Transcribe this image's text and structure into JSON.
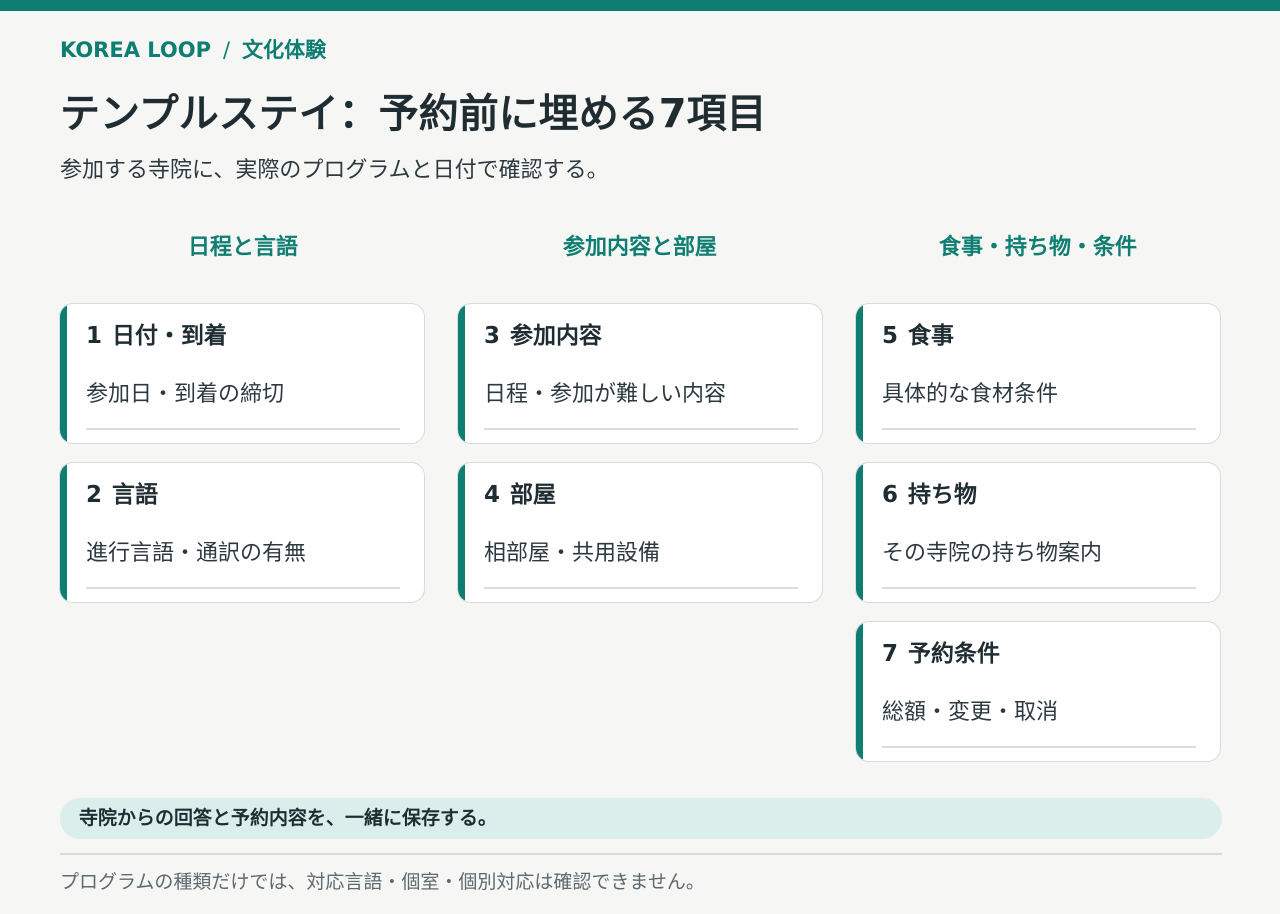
{
  "breadcrumb": {
    "site": "KOREA LOOP",
    "separator": "/",
    "section": "文化体験"
  },
  "header": {
    "title": "テンプルステイ：予約前に埋める7項目",
    "subtitle": "参加する寺院に、実際のプログラムと日付で確認する。"
  },
  "columns": [
    {
      "heading": "日程と言語",
      "cards": [
        {
          "num": "1",
          "title": "日付・到着",
          "desc": "参加日・到着の締切"
        },
        {
          "num": "2",
          "title": "言語",
          "desc": "進行言語・通訳の有無"
        }
      ]
    },
    {
      "heading": "参加内容と部屋",
      "cards": [
        {
          "num": "3",
          "title": "参加内容",
          "desc": "日程・参加が難しい内容"
        },
        {
          "num": "4",
          "title": "部屋",
          "desc": "相部屋・共用設備"
        }
      ]
    },
    {
      "heading": "食事・持ち物・条件",
      "cards": [
        {
          "num": "5",
          "title": "食事",
          "desc": "具体的な食材条件"
        },
        {
          "num": "6",
          "title": "持ち物",
          "desc": "その寺院の持ち物案内"
        },
        {
          "num": "7",
          "title": "予約条件",
          "desc": "総額・変更・取消"
        }
      ]
    }
  ],
  "callout": "寺院からの回答と予約内容を、一緒に保存する。",
  "footnote": "プログラムの種類だけでは、対応言語・個室・個別対応は確認できません。",
  "colors": {
    "accent": "#0e7d72",
    "background": "#f6f6f4",
    "callout_bg": "#dceeeb",
    "text": "#1f2d33"
  }
}
